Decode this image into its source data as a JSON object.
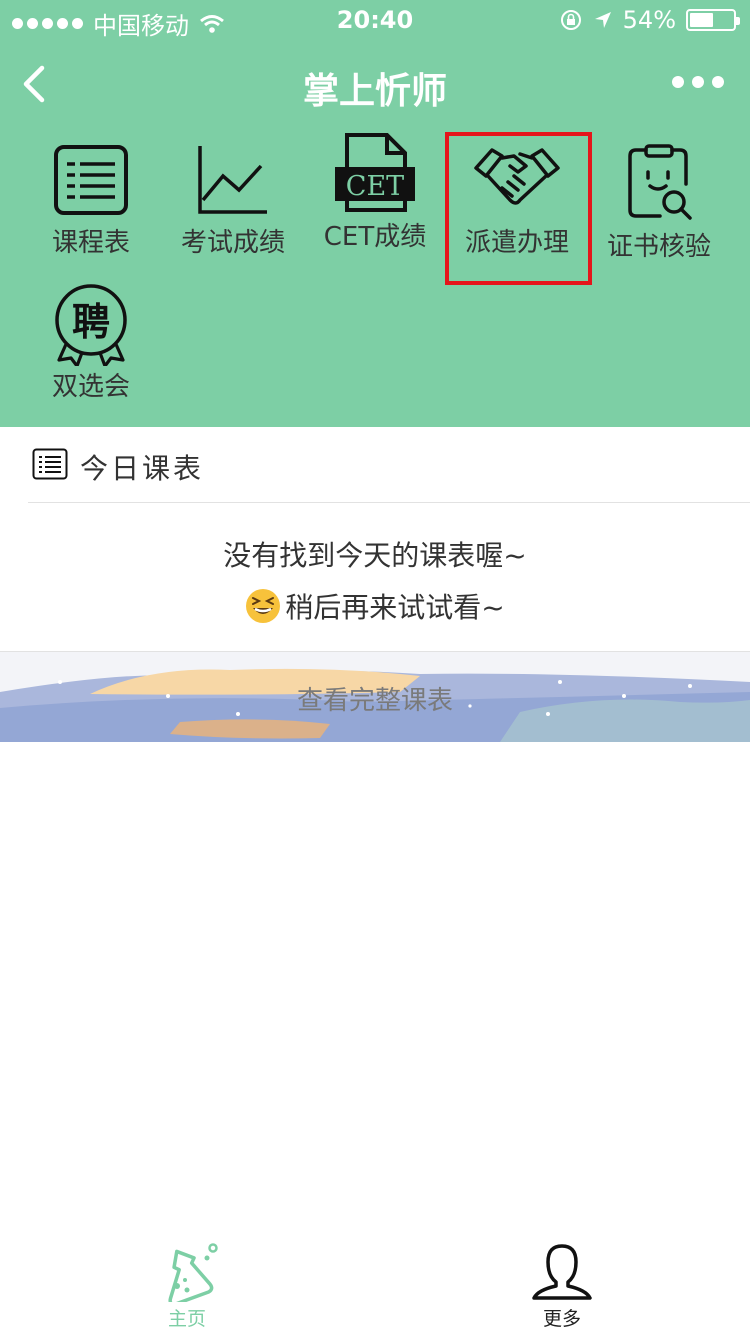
{
  "status_bar": {
    "carrier": "中国移动",
    "time": "20:40",
    "battery_percent_text": "54%",
    "battery_level": 0.54,
    "icons": [
      "signal-dots-icon",
      "wifi-icon",
      "rotation-lock-icon",
      "location-arrow-icon",
      "battery-icon"
    ]
  },
  "nav": {
    "title": "掌上忻师",
    "back_icon": "chevron-left-icon",
    "more_icon": "more-dots-icon"
  },
  "grid": {
    "items": [
      {
        "label": "课程表",
        "icon": "timetable-icon"
      },
      {
        "label": "考试成绩",
        "icon": "line-chart-icon"
      },
      {
        "label": "CET成绩",
        "icon": "cet-document-icon",
        "icon_text": "CET"
      },
      {
        "label": "派遣办理",
        "icon": "handshake-icon",
        "highlighted": true
      },
      {
        "label": "证书核验",
        "icon": "certificate-search-icon"
      },
      {
        "label": "双选会",
        "icon": "recruit-badge-icon",
        "icon_text": "聘"
      }
    ]
  },
  "today": {
    "title": "今日课表",
    "icon": "timetable-icon",
    "empty_line1": "没有找到今天的课表喔~",
    "empty_line2": "稍后再来试试看~",
    "emoji": "grinning-squint-emoji",
    "view_all": "查看完整课表"
  },
  "tabbar": {
    "items": [
      {
        "label": "主页",
        "icon": "flask-icon",
        "active": true
      },
      {
        "label": "更多",
        "icon": "user-icon",
        "active": false
      }
    ]
  },
  "colors": {
    "brand_green": "#7dcfa5",
    "highlight_red": "#e4151b",
    "text_dark": "#333333",
    "text_gray": "#7a7a7a"
  }
}
